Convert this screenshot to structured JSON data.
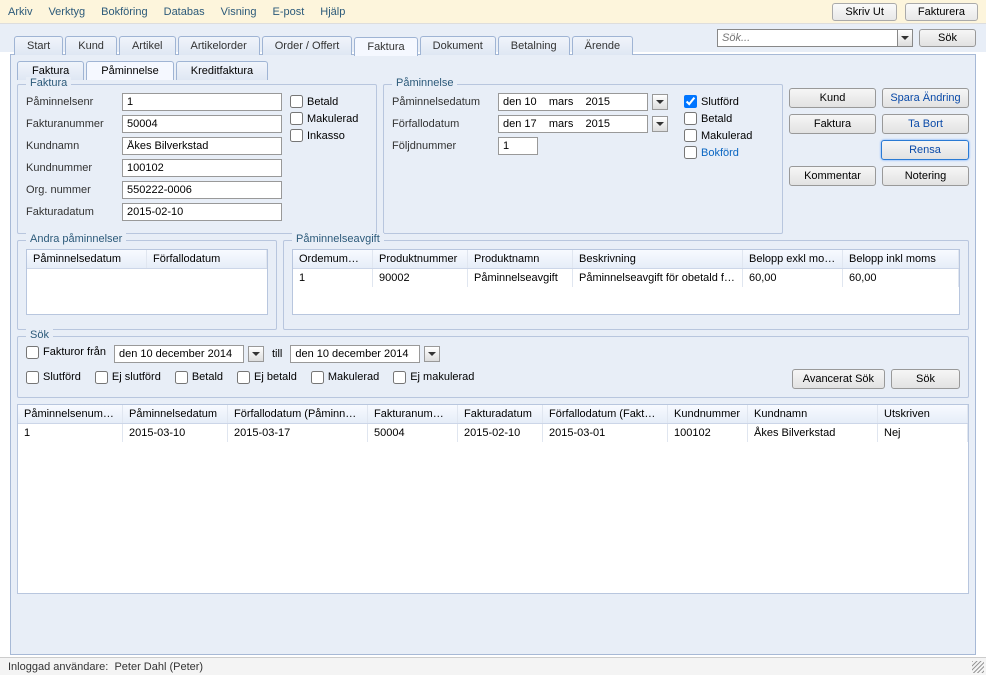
{
  "menu": {
    "items": [
      "Arkiv",
      "Verktyg",
      "Bokföring",
      "Databas",
      "Visning",
      "E-post",
      "Hjälp"
    ],
    "print": "Skriv Ut",
    "invoice": "Fakturera"
  },
  "search": {
    "placeholder": "Sök...",
    "button": "Sök"
  },
  "mainTabs": [
    "Start",
    "Kund",
    "Artikel",
    "Artikelorder",
    "Order / Offert",
    "Faktura",
    "Dokument",
    "Betalning",
    "Ärende"
  ],
  "mainTabActive": 5,
  "subTabs": [
    "Faktura",
    "Påminnelse",
    "Kreditfaktura"
  ],
  "subTabActive": 1,
  "fakturaGroup": {
    "title": "Faktura",
    "fields": {
      "paminnelsenr": {
        "label": "Påminnelsenr",
        "value": "1"
      },
      "fakturanummer": {
        "label": "Fakturanummer",
        "value": "50004"
      },
      "kundnamn": {
        "label": "Kundnamn",
        "value": "Åkes Bilverkstad"
      },
      "kundnummer": {
        "label": "Kundnummer",
        "value": "100102"
      },
      "orgnummer": {
        "label": "Org. nummer",
        "value": "550222-0006"
      },
      "fakturadatum": {
        "label": "Fakturadatum",
        "value": "2015-02-10"
      }
    },
    "checks": {
      "betald": "Betald",
      "makulerad": "Makulerad",
      "inkasso": "Inkasso"
    }
  },
  "paminnelseGroup": {
    "title": "Påminnelse",
    "fields": {
      "paminnelsedatum": {
        "label": "Påminnelsedatum",
        "value": "den 10    mars    2015"
      },
      "forfallodatum": {
        "label": "Förfallodatum",
        "value": "den 17    mars    2015"
      },
      "foljdnummer": {
        "label": "Följdnummer",
        "value": "1"
      }
    },
    "checks": {
      "slutford": {
        "label": "Slutförd",
        "checked": true
      },
      "betald": {
        "label": "Betald",
        "checked": false
      },
      "makulerad": {
        "label": "Makulerad",
        "checked": false
      },
      "bokford": {
        "label": "Bokförd",
        "checked": false
      }
    }
  },
  "actions": {
    "kund": "Kund",
    "spara": "Spara Ändring",
    "faktura": "Faktura",
    "tabort": "Ta Bort",
    "rensa": "Rensa",
    "kommentar": "Kommentar",
    "notering": "Notering"
  },
  "andra": {
    "title": "Andra påminnelser",
    "cols": [
      "Påminnelsedatum",
      "Förfallodatum"
    ]
  },
  "avgift": {
    "title": "Påminnelseavgift",
    "cols": [
      "Ordemummer",
      "Produktnummer",
      "Produktnamn",
      "Beskrivning",
      "Belopp exkl moms",
      "Belopp inkl moms"
    ],
    "row": [
      "1",
      "90002",
      "Påminnelseavgift",
      "Påminnelseavgift för obetald fa...",
      "60,00",
      "60,00"
    ]
  },
  "sok": {
    "title": "Sök",
    "fakturorFran": "Fakturor från",
    "date1": "den 10 december 2014",
    "till": "till",
    "date2": "den 10 december 2014",
    "checks": [
      "Slutförd",
      "Ej slutförd",
      "Betald",
      "Ej betald",
      "Makulerad",
      "Ej makulerad"
    ],
    "adv": "Avancerat Sök",
    "search": "Sök"
  },
  "results": {
    "cols": [
      "Påminnelsenummer",
      "Påminnelsedatum",
      "Förfallodatum (Påminnelse)",
      "Fakturanummer",
      "Fakturadatum",
      "Förfallodatum (Faktura)",
      "Kundnummer",
      "Kundnamn",
      "Utskriven"
    ],
    "row": [
      "1",
      "2015-03-10",
      "2015-03-17",
      "50004",
      "2015-02-10",
      "2015-03-01",
      "100102",
      "Åkes Bilverkstad",
      "Nej"
    ]
  },
  "status": {
    "label": "Inloggad användare:",
    "user": "Peter Dahl (Peter)"
  }
}
